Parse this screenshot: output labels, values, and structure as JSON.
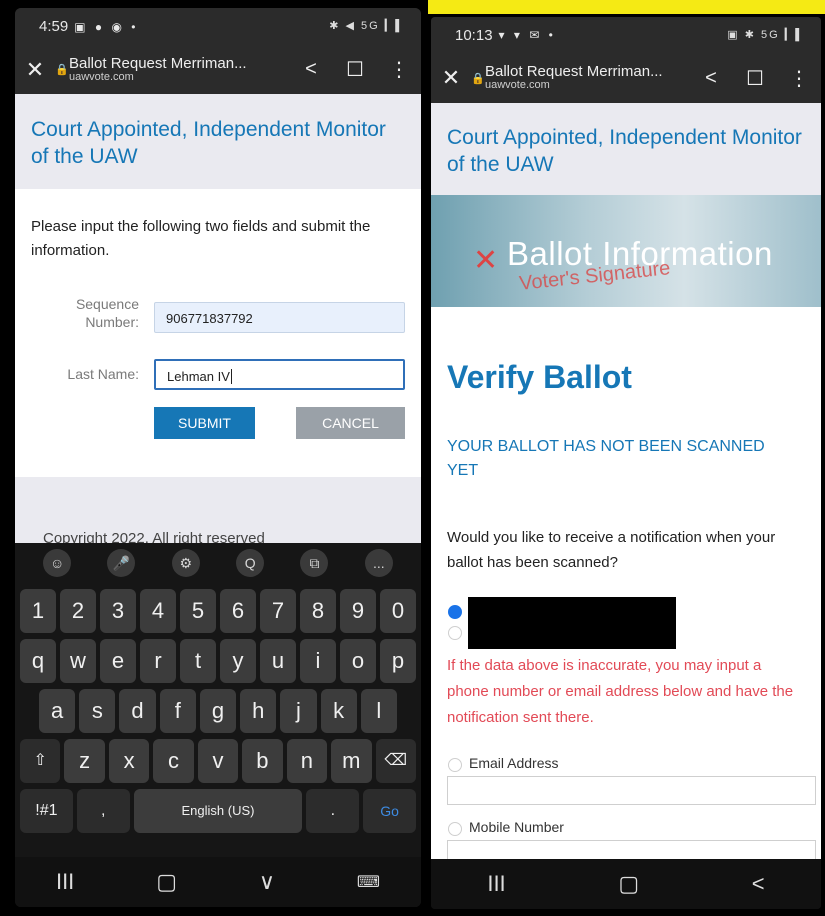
{
  "left": {
    "status": {
      "time": "4:59",
      "notif_icons": "▣ ● ◉ •",
      "sys_icons": "✱ ◀ 5G ▎▌"
    },
    "browser": {
      "title": "Ballot Request Merriman...",
      "url": "uawvote.com"
    },
    "site_title": "Court Appointed, Independent Monitor of the UAW",
    "intro": "Please input the following two fields and submit the information.",
    "sequence": {
      "label_line1": "Sequence",
      "label_line2": "Number:",
      "value": "906771837792"
    },
    "last_name": {
      "label": "Last Name:",
      "value": "Lehman IV"
    },
    "submit_label": "SUBMIT",
    "cancel_label": "CANCEL",
    "copyright": "Copyright 2022. All right reserved",
    "keyboard": {
      "top": [
        "☺",
        "🎤",
        "⚙",
        "Q",
        "⧉",
        "..."
      ],
      "numbers": [
        "1",
        "2",
        "3",
        "4",
        "5",
        "6",
        "7",
        "8",
        "9",
        "0"
      ],
      "row1": [
        "q",
        "w",
        "e",
        "r",
        "t",
        "y",
        "u",
        "i",
        "o",
        "p"
      ],
      "row2": [
        "a",
        "s",
        "d",
        "f",
        "g",
        "h",
        "j",
        "k",
        "l"
      ],
      "row3": [
        "⇧",
        "z",
        "x",
        "c",
        "v",
        "b",
        "n",
        "m",
        "⌫"
      ],
      "sym": "!#1",
      "comma": ",",
      "space": "English (US)",
      "period": ".",
      "go": "Go"
    },
    "nav": [
      "III",
      "▢",
      "∨",
      "⌨"
    ]
  },
  "right": {
    "status": {
      "time": "10:13",
      "notif_icons": "▾ ▾ ✉ •",
      "sys_icons": "▣ ✱ 5G ▎▌"
    },
    "browser": {
      "title": "Ballot Request Merriman...",
      "url": "uawvote.com"
    },
    "site_title": "Court Appointed, Independent Monitor of the UAW",
    "hero": {
      "title": "Ballot Information",
      "signature": "Voter's Signature"
    },
    "heading": "Verify Ballot",
    "notice": "YOUR BALLOT HAS NOT BEEN SCANNED YET",
    "question": "Would you like to receive a notification when your ballot has been scanned?",
    "warning": "If the data above is inaccurate, you may input a phone number or email address below and have the notification sent there.",
    "email_label": "Email Address",
    "mobile_label": "Mobile Number",
    "nav": [
      "III",
      "▢",
      "<"
    ]
  },
  "colors": {
    "accent": "#1677b6",
    "warning": "#e24a56",
    "highlight": "#f5ea14"
  }
}
